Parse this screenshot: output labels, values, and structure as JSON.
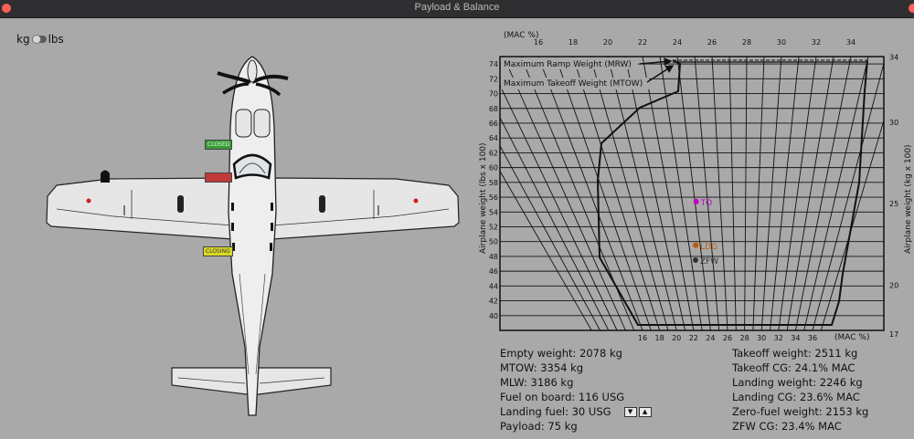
{
  "window": {
    "title": "Payload & Balance"
  },
  "unit_toggle": {
    "left_label": "kg",
    "right_label": "lbs"
  },
  "doors": {
    "front": {
      "status": "CLOSED",
      "color": "#3a9a3a"
    },
    "rear_left": {
      "status": "",
      "color": "#c03a3a"
    },
    "cargo": {
      "status": "CLOSING",
      "color": "#d9d92a"
    }
  },
  "chart": {
    "top_axis_label": "(MAC %)",
    "bottom_axis_label": "(MAC %)",
    "left_axis_label": "Airplane weight (lbs x 100)",
    "right_axis_label": "Airplane weight (kg x 100)",
    "mrw_label": "Maximum Ramp Weight (MRW)",
    "mtow_label": "Maximum Takeoff Weight (MTOW)",
    "top_ticks": [
      "16",
      "18",
      "20",
      "22",
      "24",
      "26",
      "28",
      "30",
      "32",
      "34"
    ],
    "bottom_ticks": [
      "16",
      "18",
      "20",
      "22",
      "24",
      "26",
      "28",
      "30",
      "32",
      "34",
      "36"
    ],
    "left_ticks": [
      "40",
      "42",
      "44",
      "46",
      "48",
      "50",
      "52",
      "54",
      "56",
      "58",
      "60",
      "62",
      "64",
      "66",
      "68",
      "70",
      "72",
      "74"
    ],
    "right_ticks": [
      "17",
      "20",
      "25",
      "30",
      "34"
    ]
  },
  "chart_data": {
    "type": "scatter",
    "title": "",
    "xlabel": "(MAC %)",
    "ylabel": "Airplane weight (lbs x 100)",
    "ylim": [
      38,
      75
    ],
    "points": [
      {
        "label": "TO",
        "mac": 24.1,
        "lbs_x100": 55.4,
        "color": "#c000c0"
      },
      {
        "label": "LDG",
        "mac": 23.6,
        "lbs_x100": 49.5,
        "color": "#b85a10"
      },
      {
        "label": "ZFW",
        "mac": 23.4,
        "lbs_x100": 47.5,
        "color": "#333333"
      }
    ]
  },
  "stats": {
    "left": [
      "Empty weight: 2078 kg",
      "MTOW: 3354 kg",
      "MLW: 3186 kg",
      "Fuel on board: 116 USG",
      "Landing fuel: 30 USG",
      "Payload: 75 kg"
    ],
    "right": [
      "Takeoff weight: 2511 kg",
      "Takeoff CG: 24.1% MAC",
      "Landing weight: 2246 kg",
      "Landing CG: 23.6% MAC",
      "Zero-fuel weight: 2153 kg",
      "ZFW CG: 23.4% MAC"
    ],
    "stepper_down": "▼",
    "stepper_up": "▲"
  }
}
